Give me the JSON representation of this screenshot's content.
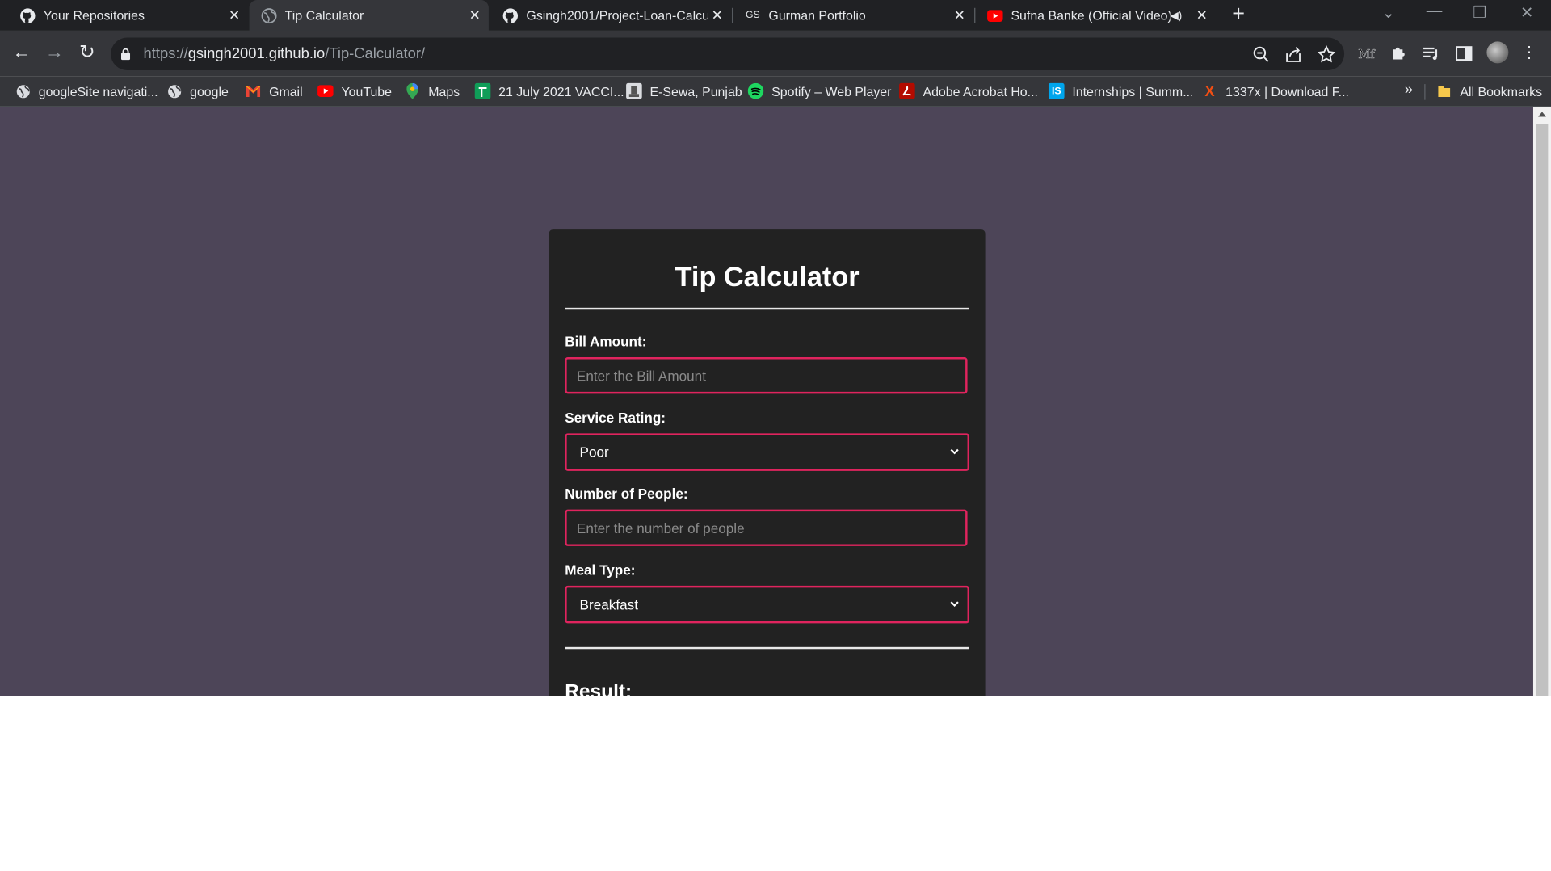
{
  "browser": {
    "tabs": [
      {
        "title": "Your Repositories",
        "icon": "github-icon"
      },
      {
        "title": "Tip Calculator",
        "icon": "globe-icon",
        "active": true
      },
      {
        "title": "Gsingh2001/Project-Loan-Calcul",
        "icon": "github-icon"
      },
      {
        "title": "Gurman Portfolio",
        "icon": "gs-favicon",
        "favicon_text": "GS"
      },
      {
        "title": "Sufna Banke (Official Video)",
        "icon": "youtube-icon"
      }
    ],
    "url": {
      "scheme": "https://",
      "host": "gsingh2001.github.io",
      "path": "/Tip-Calculator/"
    },
    "bookmarks": [
      {
        "label": "googleSite navigati...",
        "icon": "globe-icon"
      },
      {
        "label": "google",
        "icon": "globe-icon"
      },
      {
        "label": "Gmail",
        "icon": "gmail-icon"
      },
      {
        "label": "YouTube",
        "icon": "youtube-icon"
      },
      {
        "label": "Maps",
        "icon": "maps-icon"
      },
      {
        "label": "21 July 2021 VACCI...",
        "icon": "sheets-icon"
      },
      {
        "label": "E-Sewa, Punjab",
        "icon": "emblem-icon"
      },
      {
        "label": "Spotify – Web Player",
        "icon": "spotify-icon"
      },
      {
        "label": "Adobe Acrobat Ho...",
        "icon": "acrobat-icon"
      },
      {
        "label": "Internships | Summ...",
        "icon": "internshala-icon",
        "favicon_text": "IS"
      },
      {
        "label": "1337x | Download F...",
        "icon": "x-icon",
        "favicon_text": "X"
      }
    ],
    "more_bookmarks": "»",
    "all_bookmarks": "All Bookmarks"
  },
  "page": {
    "title": "Tip Calculator",
    "bill_amount": {
      "label": "Bill Amount:",
      "placeholder": "Enter the Bill Amount",
      "value": ""
    },
    "service_rating": {
      "label": "Service Rating:",
      "selected": "Poor"
    },
    "people": {
      "label": "Number of People:",
      "placeholder": "Enter the number of people",
      "value": ""
    },
    "meal_type": {
      "label": "Meal Type:",
      "selected": "Breakfast"
    },
    "result_heading": "Result:"
  },
  "colors": {
    "page_background": "#4d4558",
    "card_background": "#222222",
    "input_border": "#e0245e",
    "browser_frame": "#202124",
    "browser_toolbar": "#35363a"
  }
}
